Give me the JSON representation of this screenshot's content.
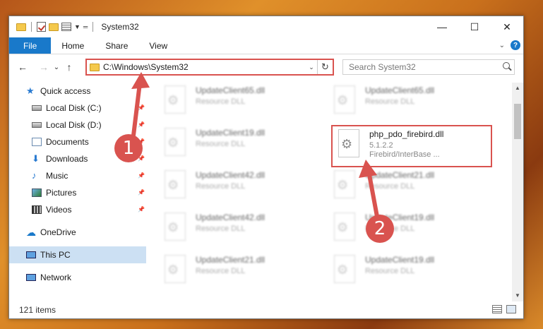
{
  "window": {
    "title": "System32",
    "controls": {
      "minimize": "—",
      "maximize": "☐",
      "close": "✕"
    }
  },
  "ribbon": {
    "tabs": [
      {
        "label": "File"
      },
      {
        "label": "Home"
      },
      {
        "label": "Share"
      },
      {
        "label": "View"
      }
    ],
    "help": "?"
  },
  "nav": {
    "back": "←",
    "forward": "→",
    "recent": "⌄",
    "up": "↑",
    "address": "C:\\Windows\\System32",
    "refresh": "↻",
    "search_placeholder": "Search System32"
  },
  "sidebar": {
    "items": [
      {
        "label": "Quick access"
      },
      {
        "label": "Local Disk (C:)"
      },
      {
        "label": "Local Disk (D:)"
      },
      {
        "label": "Documents"
      },
      {
        "label": "Downloads"
      },
      {
        "label": "Music"
      },
      {
        "label": "Pictures"
      },
      {
        "label": "Videos"
      },
      {
        "label": "OneDrive"
      },
      {
        "label": "This PC"
      },
      {
        "label": "Network"
      }
    ]
  },
  "files": {
    "left": [
      {
        "name": "UpdateClient65.dll",
        "type": "Resource DLL"
      },
      {
        "name": "UpdateClient19.dll",
        "type": "Resource DLL"
      },
      {
        "name": "UpdateClient42.dll",
        "type": "Resource DLL"
      },
      {
        "name": "UpdateClient42.dll",
        "type": "Resource DLL"
      },
      {
        "name": "UpdateClient21.dll",
        "type": "Resource DLL"
      }
    ],
    "right": [
      {
        "name": "UpdateClient65.dll",
        "type": "Resource DLL"
      },
      {
        "name": "UpdateClient21.dll",
        "type": "Resource DLL"
      },
      {
        "name": "UpdateClient19.dll",
        "type": "Resource DLL"
      },
      {
        "name": "UpdateClient19.dll",
        "type": "Resource DLL"
      }
    ],
    "highlighted": {
      "name": "php_pdo_firebird.dll",
      "version": "5.1.2.2",
      "description": "Firebird/InterBase ..."
    }
  },
  "status": {
    "item_count": "121 items"
  },
  "annotations": {
    "step1": "1",
    "step2": "2"
  },
  "colors": {
    "accent": "#1979ca",
    "highlight": "#d9534f"
  }
}
